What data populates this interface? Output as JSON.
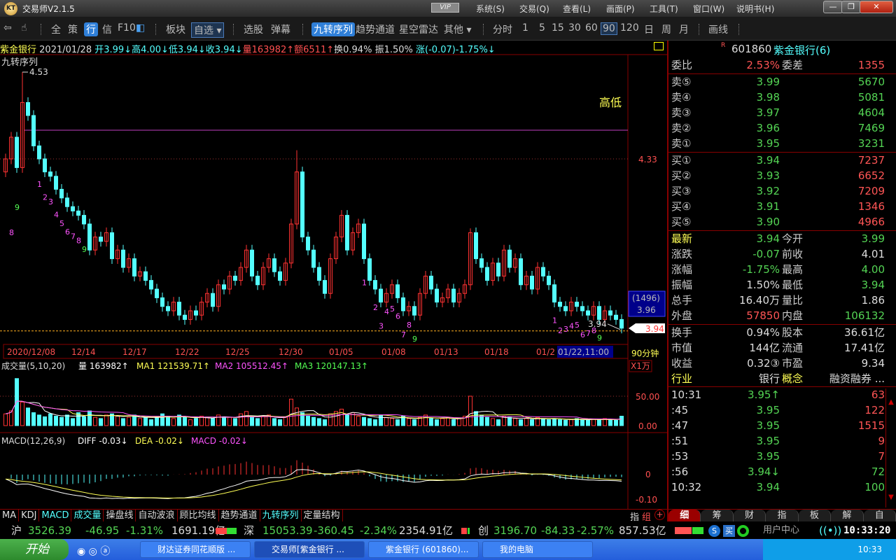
{
  "app": {
    "title": "交易师V2.1.5",
    "logo": "KT",
    "vip": "VIP",
    "menus": [
      "系统(S)",
      "交易(Q)",
      "查看(L)",
      "画面(P)",
      "工具(T)",
      "窗口(W)",
      "说明书(H)"
    ]
  },
  "toolbar": {
    "nav": [
      "全",
      "策",
      "行",
      "信",
      "F10"
    ],
    "bk": "板块",
    "zx": "自选",
    "xg": "选股",
    "dm": "弹幕",
    "indicators": [
      "九转序列",
      "趋势通道",
      "星空雷达",
      "其他"
    ],
    "periods": [
      "分时",
      "1",
      "5",
      "15",
      "30",
      "60",
      "90",
      "120",
      "日",
      "周",
      "月"
    ],
    "draw": "画线",
    "selected_period": "90"
  },
  "info": {
    "name": "紫金银行",
    "date": "2021/01/28",
    "open": "开3.99↓",
    "high": "高4.00↓",
    "low": "低3.94↓",
    "close": "收3.94↓",
    "vol": "量163982↑",
    "amt": "额6511↑",
    "turn": "换0.94%",
    "amp": "振1.50%",
    "chg": "涨(-0.07)-1.75%↓",
    "ind": "九转序列",
    "hl": "高低"
  },
  "chart_data": {
    "type": "candlestick",
    "period": "90分钟",
    "ylim": [
      3.9,
      4.56
    ],
    "price_ticks": [
      "4.33"
    ],
    "max_label": "4.53",
    "last_label": "3.94",
    "cursor_price": "3.96",
    "cursor_count": "(1496)",
    "last_price_tag": "3.94",
    "cursor_time": "01/22,11:00",
    "x_labels": [
      "2020/12/08",
      "12/14",
      "12/17",
      "12/22",
      "12/25",
      "12/30",
      "01/05",
      "01/08",
      "01/13",
      "01/18",
      "01/2"
    ],
    "closes": [
      4.33,
      4.38,
      4.31,
      4.46,
      4.43,
      4.36,
      4.33,
      4.3,
      4.29,
      4.26,
      4.24,
      4.22,
      4.21,
      4.2,
      4.18,
      4.12,
      4.15,
      4.14,
      4.16,
      4.1,
      4.12,
      4.08,
      4.1,
      4.06,
      4.07,
      4.05,
      4.03,
      4.01,
      3.99,
      3.98,
      4.0,
      3.97,
      3.96,
      3.98,
      3.97,
      4.0,
      4.02,
      3.99,
      4.04,
      4.03,
      4.06,
      4.05,
      4.08,
      4.12,
      4.06,
      4.04,
      4.08,
      4.1,
      4.07,
      4.05,
      4.09,
      4.18,
      4.3,
      4.15,
      4.12,
      4.08,
      4.05,
      4.02,
      4.1,
      4.15,
      4.2,
      4.12,
      4.16,
      4.18,
      4.1,
      4.05,
      4.03,
      4.0,
      4.02,
      4.04,
      4.01,
      3.98,
      3.99,
      3.97,
      4.02,
      4.06,
      4.03,
      4.0,
      4.01,
      4.03,
      4.0,
      4.02,
      4.04,
      4.16,
      4.1,
      4.08,
      4.05,
      4.09,
      4.06,
      4.12,
      4.08,
      4.1,
      4.04,
      4.06,
      4.03,
      4.08,
      4.06,
      4.04,
      4.0,
      3.99,
      3.98,
      4.0,
      3.99,
      3.98,
      3.97,
      3.99,
      3.96,
      3.98,
      3.97,
      3.96,
      3.94
    ],
    "volumes": [
      20,
      25,
      80,
      40,
      30,
      22,
      18,
      15,
      20,
      16,
      14,
      18,
      12,
      22,
      15,
      25,
      14,
      12,
      18,
      20,
      16,
      12,
      14,
      18,
      12,
      15,
      10,
      14,
      20,
      16,
      12,
      18,
      14,
      10,
      12,
      16,
      14,
      12,
      18,
      15,
      14,
      12,
      20,
      24,
      14,
      12,
      16,
      18,
      12,
      10,
      14,
      45,
      30,
      22,
      16,
      14,
      12,
      10,
      20,
      24,
      28,
      18,
      22,
      16,
      14,
      12,
      10,
      18,
      14,
      12,
      10,
      16,
      12,
      10,
      14,
      18,
      12,
      10,
      12,
      14,
      10,
      12,
      16,
      50,
      24,
      18,
      14,
      12,
      10,
      16,
      14,
      12,
      10,
      12,
      10,
      14,
      12,
      10,
      12,
      10,
      9,
      10,
      12,
      10,
      9,
      11,
      10,
      12,
      10,
      9,
      16
    ],
    "td_marks": [
      {
        "i": 1,
        "t": "8",
        "c": "#ff54ff"
      },
      {
        "i": 2,
        "t": "9",
        "c": "#54ff54"
      },
      {
        "i": 6,
        "t": "1",
        "c": "#ff54ff"
      },
      {
        "i": 7,
        "t": "2",
        "c": "#ff54ff"
      },
      {
        "i": 8,
        "t": "3",
        "c": "#ff54ff"
      },
      {
        "i": 9,
        "t": "4",
        "c": "#ff54ff"
      },
      {
        "i": 10,
        "t": "5",
        "c": "#ff54ff"
      },
      {
        "i": 11,
        "t": "6",
        "c": "#ff54ff"
      },
      {
        "i": 12,
        "t": "7",
        "c": "#ff54ff"
      },
      {
        "i": 13,
        "t": "8",
        "c": "#ff54ff"
      },
      {
        "i": 14,
        "t": "9",
        "c": "#54ff54"
      },
      {
        "i": 64,
        "t": "1",
        "c": "#ff54ff"
      },
      {
        "i": 66,
        "t": "2",
        "c": "#ff54ff"
      },
      {
        "i": 67,
        "t": "3",
        "c": "#ff54ff"
      },
      {
        "i": 68,
        "t": "4",
        "c": "#ff54ff"
      },
      {
        "i": 69,
        "t": "5",
        "c": "#ff54ff"
      },
      {
        "i": 70,
        "t": "6",
        "c": "#ff54ff"
      },
      {
        "i": 71,
        "t": "7",
        "c": "#ff54ff"
      },
      {
        "i": 72,
        "t": "8",
        "c": "#ff54ff"
      },
      {
        "i": 73,
        "t": "9",
        "c": "#54ff54"
      },
      {
        "i": 98,
        "t": "1",
        "c": "#ff54ff"
      },
      {
        "i": 99,
        "t": "2",
        "c": "#ff54ff"
      },
      {
        "i": 100,
        "t": "3",
        "c": "#ff54ff"
      },
      {
        "i": 101,
        "t": "4",
        "c": "#ff54ff"
      },
      {
        "i": 102,
        "t": "5",
        "c": "#ff54ff"
      },
      {
        "i": 103,
        "t": "6",
        "c": "#ff54ff"
      },
      {
        "i": 104,
        "t": "7",
        "c": "#ff54ff"
      },
      {
        "i": 105,
        "t": "8",
        "c": "#ff54ff"
      },
      {
        "i": 106,
        "t": "9",
        "c": "#54ff54"
      }
    ],
    "volume_panel": {
      "title": "成交量(5,10,20)",
      "vol": "量 163982↑",
      "ma1": "MA1 121539.71↑",
      "ma2": "MA2 105512.45↑",
      "ma3": "MA3 120147.13↑",
      "unit": "X1万",
      "ticks": [
        "50.00",
        "0.00"
      ]
    },
    "macd_panel": {
      "title": "MACD(12,26,9)",
      "diff": "DIFF -0.03↓",
      "dea": "DEA -0.02↓",
      "macd": "MACD -0.02↓",
      "ticks": [
        "0",
        "-0.10"
      ]
    }
  },
  "colors": {
    "up": "#ff3232",
    "down": "#54ffff",
    "border": "#880000"
  },
  "right": {
    "code": "601860",
    "name": "紫金银行(6)",
    "flag": "R",
    "wb": {
      "l1": "委比",
      "v1": "2.53%",
      "l2": "委差",
      "v2": "1355"
    },
    "asks": [
      [
        "卖⑤",
        "3.99",
        "5670"
      ],
      [
        "卖④",
        "3.98",
        "5081"
      ],
      [
        "卖③",
        "3.97",
        "4604"
      ],
      [
        "卖②",
        "3.96",
        "7469"
      ],
      [
        "卖①",
        "3.95",
        "3231"
      ]
    ],
    "bids": [
      [
        "买①",
        "3.94",
        "7237"
      ],
      [
        "买②",
        "3.93",
        "6652"
      ],
      [
        "买③",
        "3.92",
        "7209"
      ],
      [
        "买④",
        "3.91",
        "1346"
      ],
      [
        "买⑤",
        "3.90",
        "4966"
      ]
    ],
    "stats": [
      [
        "最新",
        "3.94",
        "今开",
        "3.99"
      ],
      [
        "涨跌",
        "-0.07",
        "前收",
        "4.01"
      ],
      [
        "涨幅",
        "-1.75%",
        "最高",
        "4.00"
      ],
      [
        "振幅",
        "1.50%",
        "最低",
        "3.94"
      ],
      [
        "总手",
        "16.40万",
        "量比",
        "1.86"
      ],
      [
        "外盘",
        "57850",
        "内盘",
        "106132"
      ]
    ],
    "fund": [
      [
        "换手",
        "0.94%",
        "股本",
        "36.61亿"
      ],
      [
        "市值",
        "144亿",
        "流通",
        "17.41亿"
      ],
      [
        "收益",
        "0.32③",
        "市盈",
        "9.34"
      ],
      [
        "行业",
        "银行",
        "概念",
        "融资融券 ..."
      ]
    ],
    "ticks": [
      [
        "10:31",
        "3.95↑",
        "63"
      ],
      [
        ":45",
        "3.95",
        "122"
      ],
      [
        ":47",
        "3.95",
        "1515"
      ],
      [
        ":51",
        "3.95",
        "9"
      ],
      [
        ":53",
        "3.95",
        "7"
      ],
      [
        ":56",
        "3.94↓",
        "72"
      ],
      [
        "10:32",
        "3.94",
        "100"
      ]
    ],
    "tabs": [
      "细",
      "筹",
      "财",
      "指",
      "板",
      "解",
      "自"
    ]
  },
  "itabs": [
    "MA",
    "KDJ",
    "MACD",
    "成交量",
    "操盘线",
    "自动波浪",
    "顾比均线",
    "趋势通道",
    "九转序列",
    "定量结构"
  ],
  "itabs_right": [
    "指",
    "组"
  ],
  "index": {
    "sh": [
      "沪",
      "3526.39",
      "-46.95",
      "-1.31%",
      "1691.19亿"
    ],
    "sz": [
      "深",
      "15053.39",
      "-360.45",
      "-2.34%",
      "2354.91亿"
    ],
    "cy": [
      "创",
      "3196.70",
      "-84.33",
      "-2.57%",
      "857.53亿"
    ],
    "user": "用户中心",
    "clock": "10:33:20"
  },
  "taskbar": {
    "start": "开始",
    "tasks": [
      "财达证券同花顺版 ...",
      "交易师[紫金银行 ...",
      "紫金银行 (601860)...",
      "我的电脑"
    ],
    "time": "10:33"
  }
}
